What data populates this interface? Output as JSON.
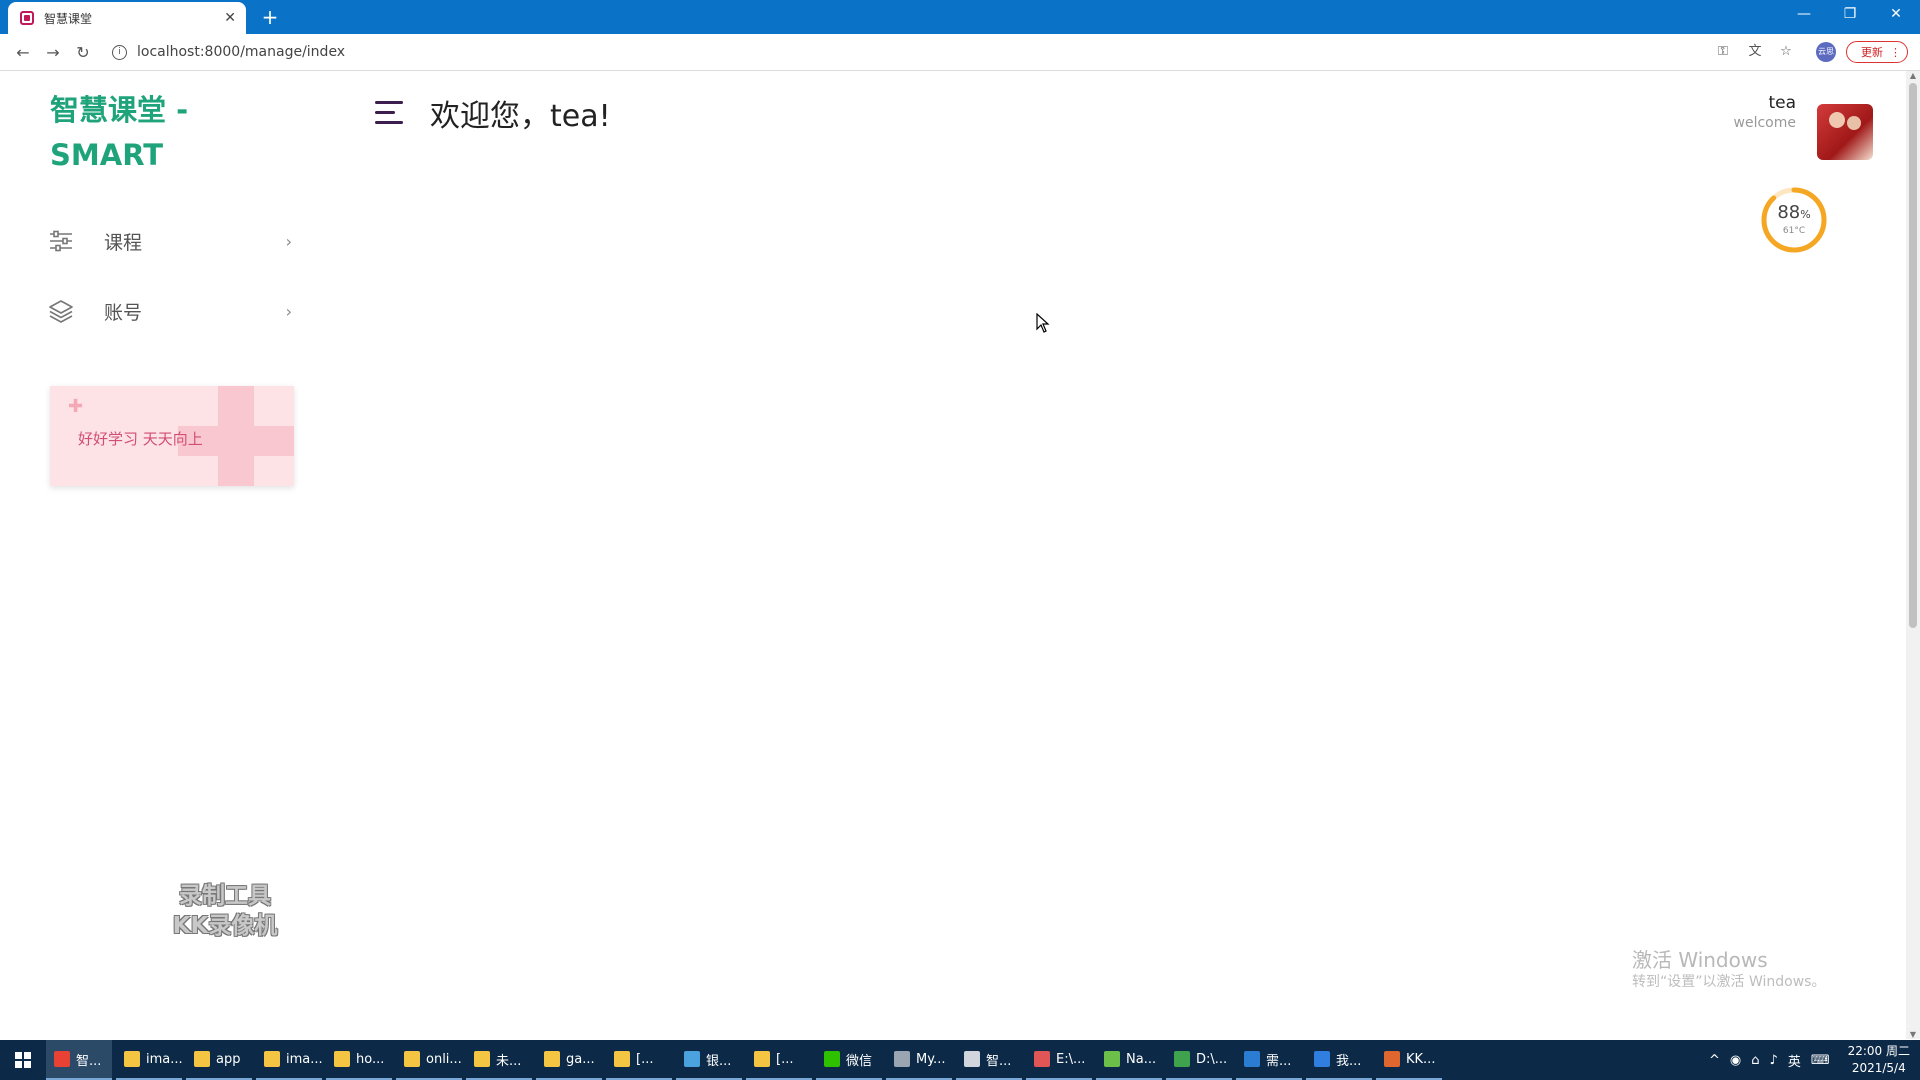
{
  "browser": {
    "tab_title": "智慧课堂",
    "tab_close": "✕",
    "new_tab": "+",
    "url": "localhost:8000/manage/index",
    "profile_badge": "云思",
    "update_label": "更新",
    "window_controls": {
      "minimize": "—",
      "restore": "❐",
      "close": "✕"
    }
  },
  "sidebar": {
    "brand": "智慧课堂 - SMART",
    "items": [
      {
        "label": "课程",
        "icon": "sliders-icon"
      },
      {
        "label": "账号",
        "icon": "layers-icon"
      }
    ],
    "promo_text": "好好学习 天天向上"
  },
  "header": {
    "welcome": "欢迎您，tea!",
    "user_name": "tea",
    "user_sub": "welcome"
  },
  "gauge": {
    "value": "88",
    "unit": "%",
    "temp": "61°C",
    "fraction": 0.88,
    "color": "#f5a623"
  },
  "overlay": {
    "watermark_line1": "录制工具",
    "watermark_line2": "KK录像机",
    "activate_title": "激活 Windows",
    "activate_sub": "转到“设置”以激活 Windows。"
  },
  "taskbar": {
    "items": [
      {
        "label": "智...",
        "color": "#e94235",
        "active": true
      },
      {
        "label": "ima...",
        "color": "#f4c542"
      },
      {
        "label": "app",
        "color": "#f4c542"
      },
      {
        "label": "ima...",
        "color": "#f4c542"
      },
      {
        "label": "ho...",
        "color": "#f4c542"
      },
      {
        "label": "onli...",
        "color": "#f4c542"
      },
      {
        "label": "未...",
        "color": "#f4c542"
      },
      {
        "label": "ga...",
        "color": "#f4c542"
      },
      {
        "label": "[...",
        "color": "#f4c542"
      },
      {
        "label": "银...",
        "color": "#4aa3df"
      },
      {
        "label": "[...",
        "color": "#f4c542"
      },
      {
        "label": "微信",
        "color": "#2dc100"
      },
      {
        "label": "My...",
        "color": "#9aa5b1"
      },
      {
        "label": "智...",
        "color": "#d0d6dc"
      },
      {
        "label": "E:\\...",
        "color": "#e05555"
      },
      {
        "label": "Na...",
        "color": "#6cc04a"
      },
      {
        "label": "D:\\...",
        "color": "#3fa34d"
      },
      {
        "label": "需...",
        "color": "#2b7cd3"
      },
      {
        "label": "我...",
        "color": "#2f7ee0"
      },
      {
        "label": "KK...",
        "color": "#e0662f"
      }
    ],
    "tray_lang": "英",
    "time": "22:00 周二",
    "date": "2021/5/4"
  }
}
